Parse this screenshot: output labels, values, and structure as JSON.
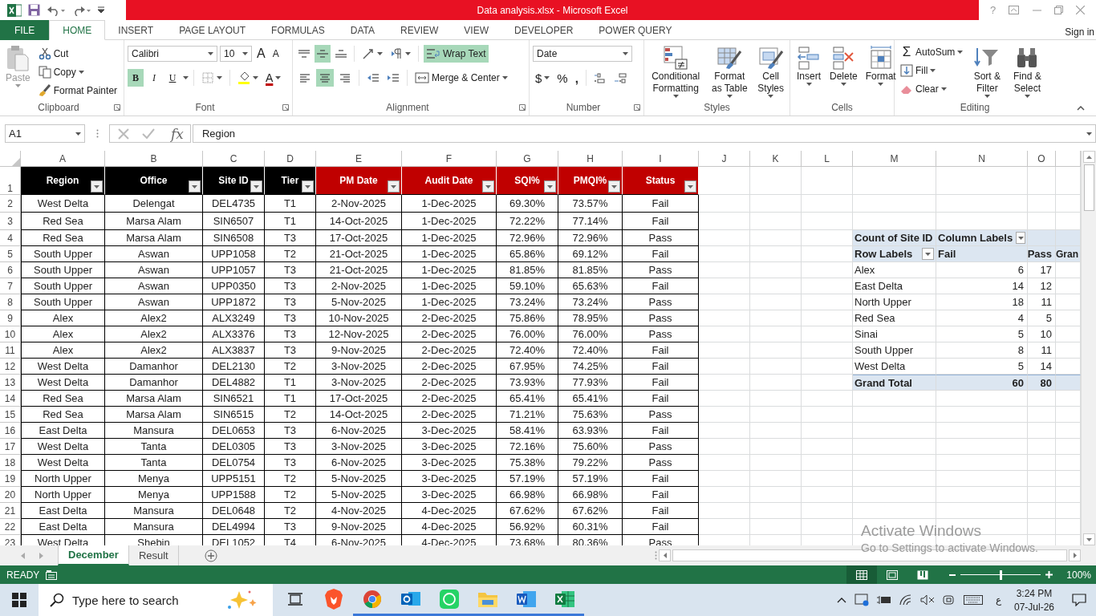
{
  "window": {
    "title": "Data analysis.xlsx  -  Microsoft Excel",
    "help": "?"
  },
  "ribbon_tabs": [
    {
      "label": "FILE",
      "kind": "file",
      "selected": false
    },
    {
      "label": "HOME",
      "kind": "tab",
      "selected": true
    },
    {
      "label": "INSERT",
      "kind": "tab",
      "selected": false
    },
    {
      "label": "PAGE LAYOUT",
      "kind": "tab",
      "selected": false
    },
    {
      "label": "FORMULAS",
      "kind": "tab",
      "selected": false
    },
    {
      "label": "DATA",
      "kind": "tab",
      "selected": false
    },
    {
      "label": "REVIEW",
      "kind": "tab",
      "selected": false
    },
    {
      "label": "VIEW",
      "kind": "tab",
      "selected": false
    },
    {
      "label": "DEVELOPER",
      "kind": "tab",
      "selected": false
    },
    {
      "label": "POWER QUERY",
      "kind": "tab",
      "selected": false
    }
  ],
  "sign_in": "Sign in",
  "ribbon": {
    "clipboard": {
      "label": "Clipboard",
      "paste": "Paste",
      "paste_disabled": true,
      "cut": "Cut",
      "copy": "Copy",
      "format_painter": "Format Painter"
    },
    "font": {
      "label": "Font",
      "font_name": "Calibri",
      "font_size": "10",
      "grow": "A",
      "shrink": "A",
      "font_color_label": "A",
      "styles": [
        {
          "label": "B",
          "selected": true
        },
        {
          "label": "I",
          "selected": false
        },
        {
          "label": "U",
          "selected": false
        }
      ]
    },
    "alignment": {
      "label": "Alignment",
      "vertical": [
        {
          "selected": false
        },
        {
          "selected": true
        },
        {
          "selected": false
        }
      ],
      "horizontal": [
        {
          "selected": false
        },
        {
          "selected": true
        },
        {
          "selected": false
        }
      ],
      "wrap_text": "Wrap Text",
      "wrap_on": true,
      "merge": "Merge & Center"
    },
    "number": {
      "label": "Number",
      "format": "Date",
      "currency": "$",
      "percent": "%",
      "comma": ","
    },
    "styles": {
      "label": "Styles",
      "buttons": [
        "Conditional Formatting",
        "Format as Table",
        "Cell Styles"
      ]
    },
    "cells": {
      "label": "Cells",
      "buttons": [
        "Insert",
        "Delete",
        "Format"
      ]
    },
    "editing": {
      "label": "Editing",
      "autosum_symbol": "Σ",
      "autosum": "AutoSum",
      "fill": "Fill",
      "clear": "Clear",
      "buttons": [
        "Sort & Filter",
        "Find & Select"
      ]
    }
  },
  "formula_bar": {
    "name_box": "A1",
    "function_label": "fx",
    "formula": "Region"
  },
  "sheet": {
    "columns": [
      "A",
      "B",
      "C",
      "D",
      "E",
      "F",
      "G",
      "H",
      "I",
      "J",
      "K",
      "L",
      "M",
      "N",
      "O"
    ],
    "row_numbers": [
      "1",
      "2",
      "3",
      "4",
      "5",
      "6",
      "7",
      "8",
      "9",
      "10",
      "11",
      "12",
      "13",
      "14",
      "15",
      "16",
      "17",
      "18",
      "19",
      "20",
      "21",
      "22",
      "23"
    ]
  },
  "table": {
    "headers": [
      {
        "label": "Region",
        "color": "#000000"
      },
      {
        "label": "Office",
        "color": "#000000"
      },
      {
        "label": "Site ID",
        "color": "#000000"
      },
      {
        "label": "Tier",
        "color": "#000000"
      },
      {
        "label": "PM Date",
        "color": "#c00000"
      },
      {
        "label": "Audit Date",
        "color": "#c00000"
      },
      {
        "label": "SQI%",
        "color": "#c00000"
      },
      {
        "label": "PMQI%",
        "color": "#c00000"
      },
      {
        "label": "Status",
        "color": "#c00000"
      }
    ],
    "rows": [
      [
        "West Delta",
        "Delengat",
        "DEL4735",
        "T1",
        "2-Nov-2025",
        "1-Dec-2025",
        "69.30%",
        "73.57%",
        "Fail"
      ],
      [
        "Red Sea",
        "Marsa Alam",
        "SIN6507",
        "T1",
        "14-Oct-2025",
        "1-Dec-2025",
        "72.22%",
        "77.14%",
        "Fail"
      ],
      [
        "Red Sea",
        "Marsa Alam",
        "SIN6508",
        "T3",
        "17-Oct-2025",
        "1-Dec-2025",
        "72.96%",
        "72.96%",
        "Pass"
      ],
      [
        "South Upper",
        "Aswan",
        "UPP1058",
        "T2",
        "21-Oct-2025",
        "1-Dec-2025",
        "65.86%",
        "69.12%",
        "Fail"
      ],
      [
        "South Upper",
        "Aswan",
        "UPP1057",
        "T3",
        "21-Oct-2025",
        "1-Dec-2025",
        "81.85%",
        "81.85%",
        "Pass"
      ],
      [
        "South Upper",
        "Aswan",
        "UPP0350",
        "T3",
        "2-Nov-2025",
        "1-Dec-2025",
        "59.10%",
        "65.63%",
        "Fail"
      ],
      [
        "South Upper",
        "Aswan",
        "UPP1872",
        "T3",
        "5-Nov-2025",
        "1-Dec-2025",
        "73.24%",
        "73.24%",
        "Pass"
      ],
      [
        "Alex",
        "Alex2",
        "ALX3249",
        "T3",
        "10-Nov-2025",
        "2-Dec-2025",
        "75.86%",
        "78.95%",
        "Pass"
      ],
      [
        "Alex",
        "Alex2",
        "ALX3376",
        "T3",
        "12-Nov-2025",
        "2-Dec-2025",
        "76.00%",
        "76.00%",
        "Pass"
      ],
      [
        "Alex",
        "Alex2",
        "ALX3837",
        "T3",
        "9-Nov-2025",
        "2-Dec-2025",
        "72.40%",
        "72.40%",
        "Fail"
      ],
      [
        "West Delta",
        "Damanhor",
        "DEL2130",
        "T2",
        "3-Nov-2025",
        "2-Dec-2025",
        "67.95%",
        "74.25%",
        "Fail"
      ],
      [
        "West Delta",
        "Damanhor",
        "DEL4882",
        "T1",
        "3-Nov-2025",
        "2-Dec-2025",
        "73.93%",
        "77.93%",
        "Fail"
      ],
      [
        "Red Sea",
        "Marsa Alam",
        "SIN6521",
        "T1",
        "17-Oct-2025",
        "2-Dec-2025",
        "65.41%",
        "65.41%",
        "Fail"
      ],
      [
        "Red Sea",
        "Marsa Alam",
        "SIN6515",
        "T2",
        "14-Oct-2025",
        "2-Dec-2025",
        "71.21%",
        "75.63%",
        "Pass"
      ],
      [
        "East Delta",
        "Mansura",
        "DEL0653",
        "T3",
        "6-Nov-2025",
        "3-Dec-2025",
        "58.41%",
        "63.93%",
        "Fail"
      ],
      [
        "West Delta",
        "Tanta",
        "DEL0305",
        "T3",
        "3-Nov-2025",
        "3-Dec-2025",
        "72.16%",
        "75.60%",
        "Pass"
      ],
      [
        "West Delta",
        "Tanta",
        "DEL0754",
        "T3",
        "6-Nov-2025",
        "3-Dec-2025",
        "75.38%",
        "79.22%",
        "Pass"
      ],
      [
        "North Upper",
        "Menya",
        "UPP5151",
        "T2",
        "5-Nov-2025",
        "3-Dec-2025",
        "57.19%",
        "57.19%",
        "Fail"
      ],
      [
        "North Upper",
        "Menya",
        "UPP1588",
        "T2",
        "5-Nov-2025",
        "3-Dec-2025",
        "66.98%",
        "66.98%",
        "Fail"
      ],
      [
        "East Delta",
        "Mansura",
        "DEL0648",
        "T2",
        "4-Nov-2025",
        "4-Dec-2025",
        "67.62%",
        "67.62%",
        "Fail"
      ],
      [
        "East Delta",
        "Mansura",
        "DEL4994",
        "T3",
        "9-Nov-2025",
        "4-Dec-2025",
        "56.92%",
        "60.31%",
        "Fail"
      ],
      [
        "West Delta",
        "Shebin",
        "DEL1052",
        "T4",
        "6-Nov-2025",
        "4-Dec-2025",
        "73.68%",
        "80.36%",
        "Pass"
      ]
    ]
  },
  "pivot": {
    "title": "Count of Site ID",
    "column_labels": "Column Labels",
    "row_labels": "Row Labels",
    "columns": [
      "Fail",
      "Pass",
      "Gran"
    ],
    "rows": [
      {
        "label": "Alex",
        "fail": "6",
        "pass": "17"
      },
      {
        "label": "East Delta",
        "fail": "14",
        "pass": "12"
      },
      {
        "label": "North Upper",
        "fail": "18",
        "pass": "11"
      },
      {
        "label": "Red Sea",
        "fail": "4",
        "pass": "5"
      },
      {
        "label": "Sinai",
        "fail": "5",
        "pass": "10"
      },
      {
        "label": "South Upper",
        "fail": "8",
        "pass": "11"
      },
      {
        "label": "West Delta",
        "fail": "5",
        "pass": "14"
      }
    ],
    "total": {
      "label": "Grand Total",
      "fail": "60",
      "pass": "80"
    }
  },
  "sheet_tabs": [
    {
      "label": "December",
      "selected": true
    },
    {
      "label": "Result",
      "selected": false
    }
  ],
  "activation_notice": {
    "title": "Activate Windows",
    "subtitle": "Go to Settings to activate Windows."
  },
  "status_bar": {
    "mode": "READY",
    "views": [
      {
        "selected": true
      },
      {
        "selected": false
      },
      {
        "selected": false
      }
    ],
    "zoom_slider": {
      "level": 0.5
    },
    "zoom": "100%"
  },
  "taskbar": {
    "search_placeholder": "Type here to search",
    "apps": [
      {
        "running": false
      },
      {
        "running": true
      },
      {
        "running": true
      },
      {
        "running": true
      },
      {
        "running": true
      },
      {
        "running": true
      },
      {
        "running": true
      }
    ],
    "language": "ع",
    "time": "3:24 PM",
    "date": "07-Jul-26"
  }
}
